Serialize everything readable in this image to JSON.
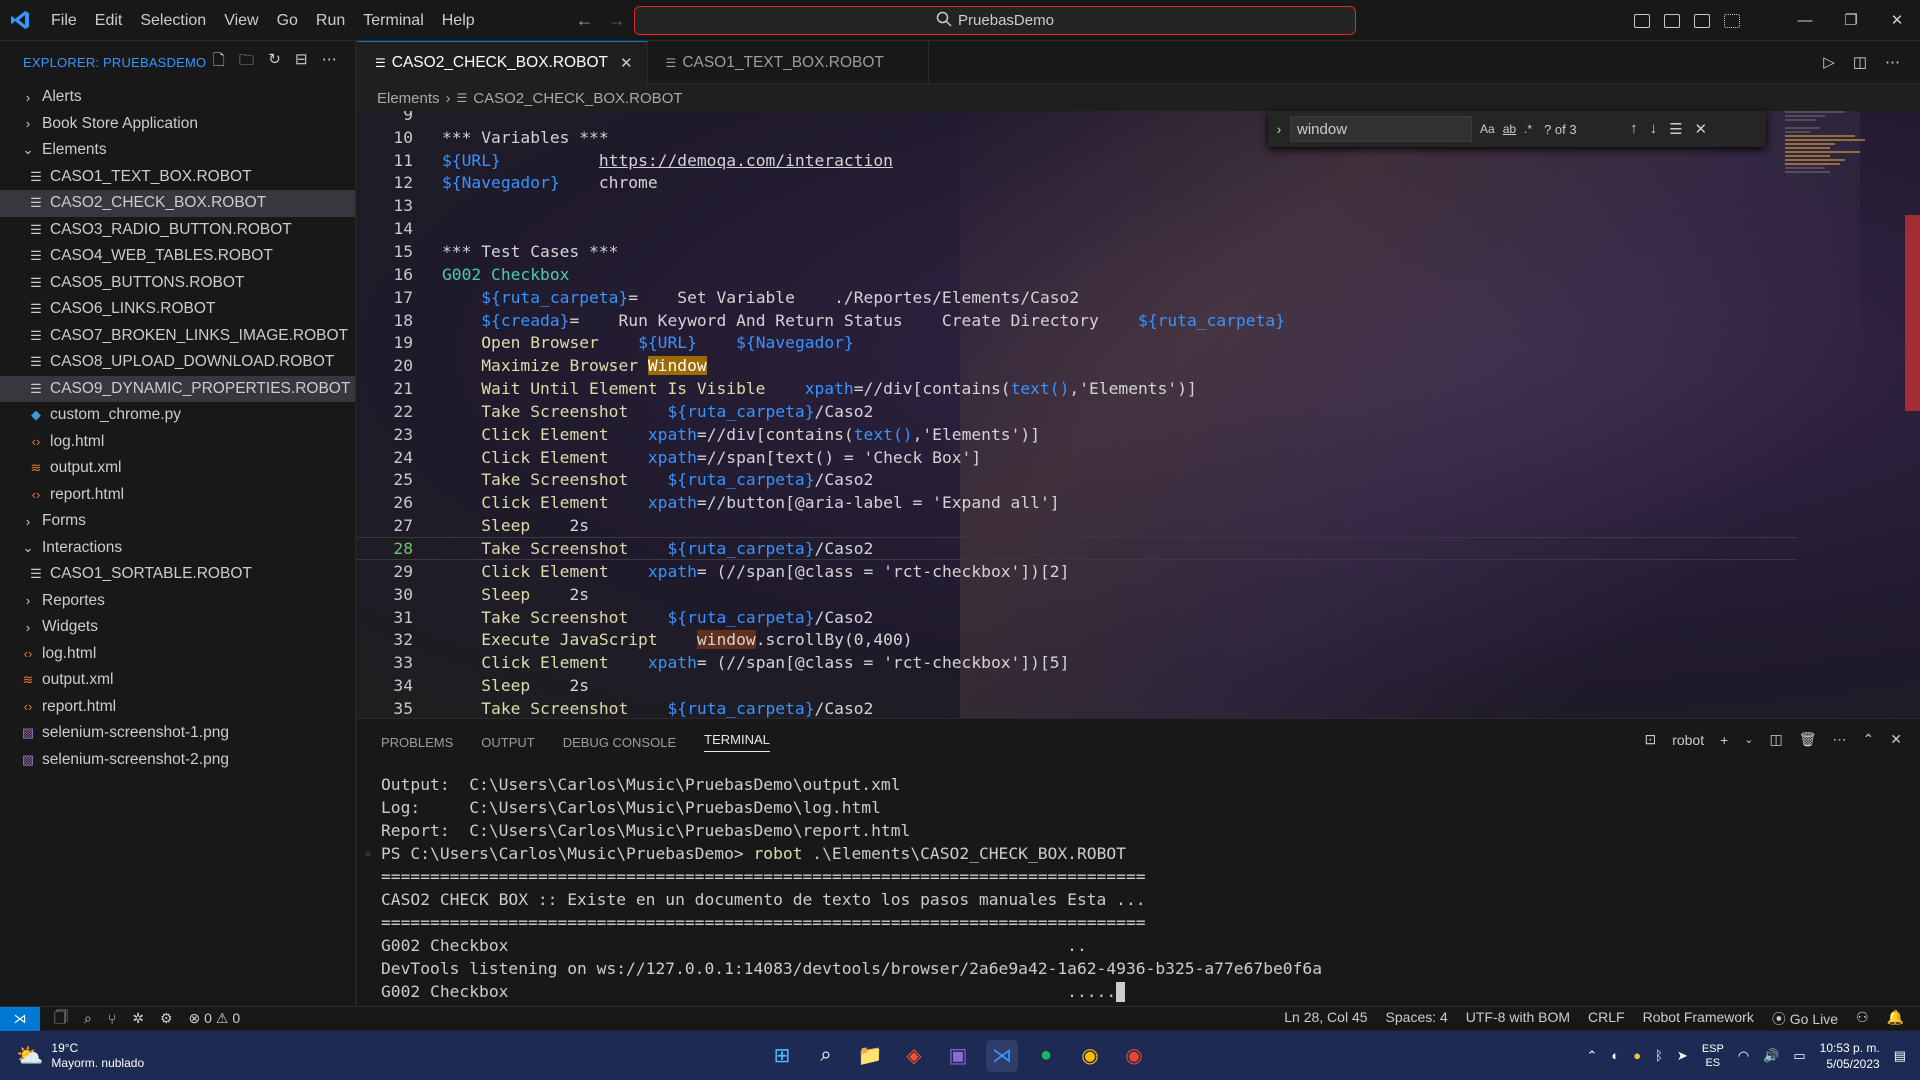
{
  "titlebar": {
    "menu": [
      "File",
      "Edit",
      "Selection",
      "View",
      "Go",
      "Run",
      "Terminal",
      "Help"
    ],
    "search": "PruebasDemo"
  },
  "explorer": {
    "header": "EXPLORER: PRUEBASDEMO",
    "tree": [
      {
        "label": "Alerts",
        "type": "folder",
        "expanded": false,
        "depth": 0
      },
      {
        "label": "Book Store Application",
        "type": "folder",
        "expanded": false,
        "depth": 0
      },
      {
        "label": "Elements",
        "type": "folder",
        "expanded": true,
        "depth": 0
      },
      {
        "label": "CASO1_TEXT_BOX.ROBOT",
        "type": "robot",
        "depth": 1
      },
      {
        "label": "CASO2_CHECK_BOX.ROBOT",
        "type": "robot",
        "depth": 1,
        "selected": true
      },
      {
        "label": "CASO3_RADIO_BUTTON.ROBOT",
        "type": "robot",
        "depth": 1
      },
      {
        "label": "CASO4_WEB_TABLES.ROBOT",
        "type": "robot",
        "depth": 1
      },
      {
        "label": "CASO5_BUTTONS.ROBOT",
        "type": "robot",
        "depth": 1
      },
      {
        "label": "CASO6_LINKS.ROBOT",
        "type": "robot",
        "depth": 1
      },
      {
        "label": "CASO7_BROKEN_LINKS_IMAGE.ROBOT",
        "type": "robot",
        "depth": 1
      },
      {
        "label": "CASO8_UPLOAD_DOWNLOAD.ROBOT",
        "type": "robot",
        "depth": 1
      },
      {
        "label": "CASO9_DYNAMIC_PROPERTIES.ROBOT",
        "type": "robot",
        "depth": 1,
        "hover": true
      },
      {
        "label": "custom_chrome.py",
        "type": "py",
        "depth": 1
      },
      {
        "label": "log.html",
        "type": "html",
        "depth": 1
      },
      {
        "label": "output.xml",
        "type": "xml",
        "depth": 1
      },
      {
        "label": "report.html",
        "type": "html",
        "depth": 1
      },
      {
        "label": "Forms",
        "type": "folder",
        "expanded": false,
        "depth": 0
      },
      {
        "label": "Interactions",
        "type": "folder",
        "expanded": true,
        "depth": 0
      },
      {
        "label": "CASO1_SORTABLE.ROBOT",
        "type": "robot",
        "depth": 1
      },
      {
        "label": "Reportes",
        "type": "folder",
        "expanded": false,
        "depth": 0
      },
      {
        "label": "Widgets",
        "type": "folder",
        "expanded": false,
        "depth": 0
      },
      {
        "label": "log.html",
        "type": "html",
        "depth": 0
      },
      {
        "label": "output.xml",
        "type": "xml",
        "depth": 0
      },
      {
        "label": "report.html",
        "type": "html",
        "depth": 0
      },
      {
        "label": "selenium-screenshot-1.png",
        "type": "png",
        "depth": 0
      },
      {
        "label": "selenium-screenshot-2.png",
        "type": "png",
        "depth": 0
      }
    ]
  },
  "tabs": [
    {
      "label": "CASO2_CHECK_BOX.ROBOT",
      "active": true
    },
    {
      "label": "CASO1_TEXT_BOX.ROBOT",
      "active": false
    }
  ],
  "breadcrumbs": [
    "Elements",
    "CASO2_CHECK_BOX.ROBOT"
  ],
  "find": {
    "query": "window",
    "count": "? of 3",
    "opt_case": "Aa",
    "opt_word": "ab",
    "opt_regex": ".*"
  },
  "editor": {
    "current_line": 28,
    "lines": [
      {
        "n": 9,
        "html": ""
      },
      {
        "n": 10,
        "html": "<span class='k-sec'>*** Variables ***</span>"
      },
      {
        "n": 11,
        "html": "<span class='k-var'>${URL}</span>          <span class='k-url'>https://demoqa.com/interaction</span>"
      },
      {
        "n": 12,
        "html": "<span class='k-var'>${Navegador}</span>    chrome"
      },
      {
        "n": 13,
        "html": ""
      },
      {
        "n": 14,
        "html": ""
      },
      {
        "n": 15,
        "html": "<span class='k-sec'>*** Test Cases ***</span>"
      },
      {
        "n": 16,
        "html": "<span class='k-tc'>G002 Checkbox</span>"
      },
      {
        "n": 17,
        "html": "    <span class='k-var'>${ruta_carpeta}</span>=    Set Variable    ./Reportes/Elements/Caso2"
      },
      {
        "n": 18,
        "html": "    <span class='k-var'>${creada}</span>=    Run Keyword And Return Status    Create Directory    <span class='k-var'>${ruta_carpeta}</span>"
      },
      {
        "n": 19,
        "html": "    <span class='k-kw'>Open Browser</span>    <span class='k-var'>${URL}</span>    <span class='k-var'>${Navegador}</span>"
      },
      {
        "n": 20,
        "html": "    <span class='k-kw'>Maximize Browser </span><span class='k-kw k-hl'>Window</span>"
      },
      {
        "n": 21,
        "html": "    <span class='k-kw'>Wait Until Element Is Visible</span>    <span class='k-var'>xpath</span>=//div[contains(<span class='k-var'>text()</span>,'Elements')]"
      },
      {
        "n": 22,
        "html": "    <span class='k-kw'>Take Screenshot</span>    <span class='k-var'>${ruta_carpeta}</span>/Caso2"
      },
      {
        "n": 23,
        "html": "    <span class='k-kw'>Click Element</span>    <span class='k-var'>xpath</span>=//div[contains(<span class='k-var'>text()</span>,'Elements')]"
      },
      {
        "n": 24,
        "html": "    <span class='k-kw'>Click Element</span>    <span class='k-var'>xpath</span>=//span[text() = 'Check Box']"
      },
      {
        "n": 25,
        "html": "    <span class='k-kw'>Take Screenshot</span>    <span class='k-var'>${ruta_carpeta}</span>/Caso2"
      },
      {
        "n": 26,
        "html": "    <span class='k-kw'>Click Element</span>    <span class='k-var'>xpath</span>=//button[@aria-label = 'Expand all']"
      },
      {
        "n": 27,
        "html": "    <span class='k-kw'>Sleep</span>    2s"
      },
      {
        "n": 28,
        "html": "    <span class='k-kw'>Take Screenshot</span>    <span class='k-var'>${ruta_carpeta}</span>/Caso2"
      },
      {
        "n": 29,
        "html": "    <span class='k-kw'>Click Element</span>    <span class='k-var'>xpath</span>= (//span[@class = 'rct-checkbox'])[2]"
      },
      {
        "n": 30,
        "html": "    <span class='k-kw'>Sleep</span>    2s"
      },
      {
        "n": 31,
        "html": "    <span class='k-kw'>Take Screenshot</span>    <span class='k-var'>${ruta_carpeta}</span>/Caso2"
      },
      {
        "n": 32,
        "html": "    <span class='k-kw'>Execute JavaScript</span>    <span class='k-hl2'>window</span>.scrollBy(0,400)"
      },
      {
        "n": 33,
        "html": "    <span class='k-kw'>Click Element</span>    <span class='k-var'>xpath</span>= (//span[@class = 'rct-checkbox'])[5]"
      },
      {
        "n": 34,
        "html": "    <span class='k-kw'>Sleep</span>    2s"
      },
      {
        "n": 35,
        "html": "    <span class='k-kw'>Take Screenshot</span>    <span class='k-var'>${ruta_carpeta}</span>/Caso2"
      }
    ]
  },
  "panel": {
    "tabs": [
      "PROBLEMS",
      "OUTPUT",
      "DEBUG CONSOLE",
      "TERMINAL"
    ],
    "active_tab": "TERMINAL",
    "terminal_name": "robot",
    "lines": [
      {
        "text": "Output:  C:\\Users\\Carlos\\Music\\PruebasDemo\\output.xml"
      },
      {
        "text": "Log:     C:\\Users\\Carlos\\Music\\PruebasDemo\\log.html"
      },
      {
        "text": "Report:  C:\\Users\\Carlos\\Music\\PruebasDemo\\report.html"
      },
      {
        "prompt": "PS C:\\Users\\Carlos\\Music\\PruebasDemo> ",
        "cmd": "robot",
        "rest": " .\\Elements\\CASO2_CHECK_BOX.ROBOT"
      },
      {
        "text": "=============================================================================="
      },
      {
        "text": "CASO2 CHECK BOX :: Existe en un documento de texto los pasos manuales Esta ..."
      },
      {
        "text": "=============================================================================="
      },
      {
        "text": "G002 Checkbox                                                         .."
      },
      {
        "text": "DevTools listening on ws://127.0.0.1:14083/devtools/browser/2a6e9a42-1a62-4936-b325-a77e67be0f6a"
      },
      {
        "text": "G002 Checkbox                                                         .....",
        "cursor": true
      }
    ]
  },
  "statusbar": {
    "problems": "0",
    "warnings": "0",
    "position": "Ln 28, Col 45",
    "spaces": "Spaces: 4",
    "encoding": "UTF-8 with BOM",
    "eol": "CRLF",
    "language": "Robot Framework",
    "golive": "Go Live"
  },
  "taskbar": {
    "temp": "19°C",
    "weather": "Mayorm. nublado",
    "lang1": "ESP",
    "lang2": "ES",
    "time": "10:53 p. m.",
    "date": "5/05/2023"
  },
  "colors": {
    "accent": "#0078d4",
    "highlight": "#9e6a03",
    "search_border": "#e0282e"
  }
}
